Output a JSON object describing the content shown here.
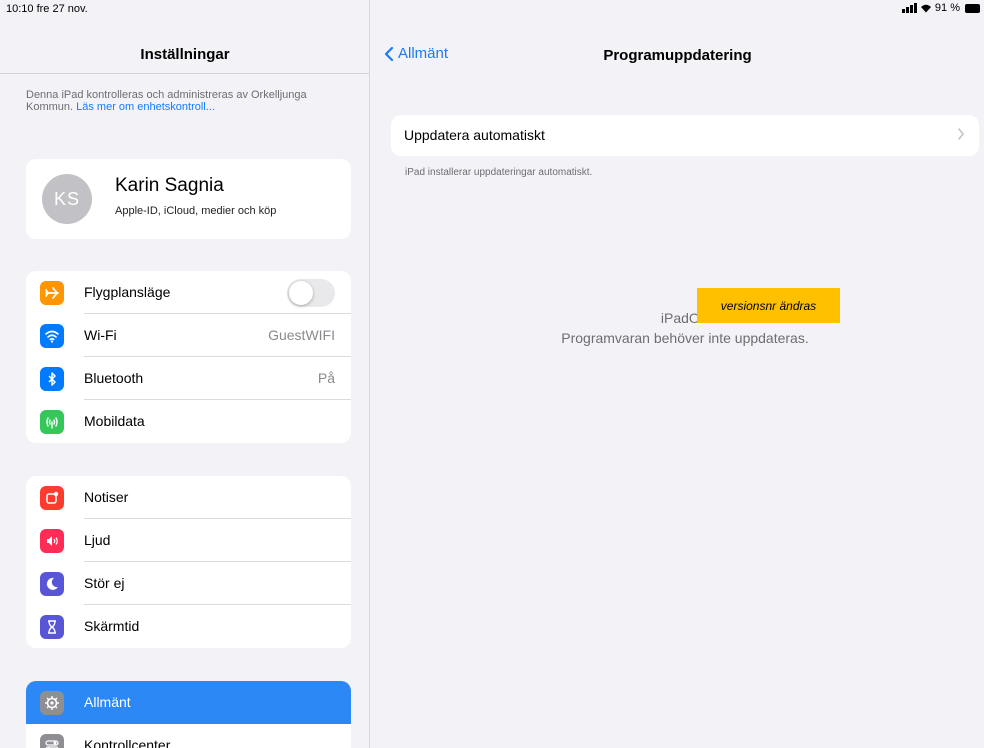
{
  "status": {
    "time_date": "10:10  fre 27 nov.",
    "battery": "91 %"
  },
  "sidebar": {
    "title": "Inställningar",
    "management_note": "Denna iPad kontrolleras och administreras av Orkelljunga Kommun.",
    "management_link": "Läs mer om enhetskontroll...",
    "profile": {
      "initials": "KS",
      "name": "Karin Sagnia",
      "subtitle": "Apple-ID, iCloud, medier och köp"
    },
    "connectivity": [
      {
        "label": "Flygplansläge",
        "icon": "airplane-icon",
        "color": "#ff9500",
        "toggle": false
      },
      {
        "label": "Wi-Fi",
        "icon": "wifi-icon",
        "color": "#007aff",
        "value": "GuestWIFI"
      },
      {
        "label": "Bluetooth",
        "icon": "bluetooth-icon",
        "color": "#007aff",
        "value": "På"
      },
      {
        "label": "Mobildata",
        "icon": "antenna-icon",
        "color": "#34c759"
      }
    ],
    "notifications": [
      {
        "label": "Notiser",
        "icon": "notifications-icon",
        "color": "#ff3b30"
      },
      {
        "label": "Ljud",
        "icon": "speaker-icon",
        "color": "#ff2d55"
      },
      {
        "label": "Stör ej",
        "icon": "moon-icon",
        "color": "#5856d6"
      },
      {
        "label": "Skärmtid",
        "icon": "hourglass-icon",
        "color": "#5856d6"
      }
    ],
    "general": [
      {
        "label": "Allmänt",
        "icon": "gear-icon",
        "color": "#8e8e93",
        "selected": true
      },
      {
        "label": "Kontrollcenter",
        "icon": "toggles-icon",
        "color": "#8e8e93"
      }
    ]
  },
  "detail": {
    "back_label": "Allmänt",
    "title": "Programuppdatering",
    "auto_update_label": "Uppdatera automatiskt",
    "auto_update_note": "iPad installerar uppdateringar automatiskt.",
    "os_name": "iPadOS",
    "status_message": "Programvaran behöver inte uppdateras.",
    "annotation": "versionsnr ändras"
  },
  "colors": {
    "accent": "#1a7cf6",
    "selected_row": "#2c88f5",
    "annotation": "#ffc000"
  }
}
